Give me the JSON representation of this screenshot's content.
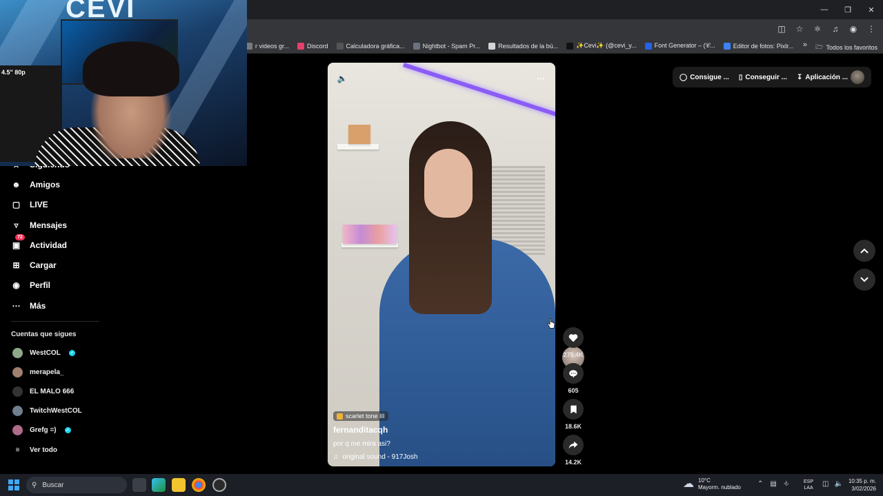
{
  "browser": {
    "bookmarks": [
      {
        "label": "r videos gr...",
        "color": "#7a7a7a"
      },
      {
        "label": "Discord",
        "color": "#e5416b"
      },
      {
        "label": "Calculadora gráfica...",
        "color": "#555555"
      },
      {
        "label": "Nightbot - Spam Pr...",
        "color": "#6b7280"
      },
      {
        "label": "Resultados de la bú...",
        "color": "#d4d4d4"
      },
      {
        "label": "✨Cevi✨ (@cevi_y...",
        "color": "#111111"
      },
      {
        "label": "Font Generator – (𝒞...",
        "color": "#2563eb"
      },
      {
        "label": "Editor de fotos: Pixlr...",
        "color": "#3b82f6"
      }
    ],
    "all_bookmarks": "Todos los favoritos"
  },
  "sidebar": {
    "partial_label": "Siguiendo",
    "items": [
      {
        "label": "Amigos",
        "icon": "friends-icon"
      },
      {
        "label": "LIVE",
        "icon": "live-icon"
      },
      {
        "label": "Mensajes",
        "icon": "messages-icon"
      },
      {
        "label": "Actividad",
        "icon": "activity-icon",
        "badge": "72"
      },
      {
        "label": "Cargar",
        "icon": "upload-icon"
      },
      {
        "label": "Perfil",
        "icon": "profile-icon"
      },
      {
        "label": "Más",
        "icon": "more-icon"
      }
    ],
    "following_title": "Cuentas que sigues",
    "following": [
      {
        "name": "WestCOL",
        "verified": true,
        "color": "#8fa88a"
      },
      {
        "name": "merapela_",
        "verified": false,
        "color": "#a08070"
      },
      {
        "name": "EL MALO 666",
        "verified": false,
        "color": "#333333"
      },
      {
        "name": "TwitchWestCOL",
        "verified": false,
        "color": "#6f7f8f"
      },
      {
        "name": "Grefg =)",
        "verified": true,
        "color": "#b06a8a"
      }
    ],
    "see_all": "Ver todo"
  },
  "video": {
    "sticker": "scarlet tone III",
    "username": "fernanditacqh",
    "caption": "por q me mira asi?",
    "sound": "original sound - 917Josh"
  },
  "actions": {
    "likes": "275.4K",
    "comments": "605",
    "saves": "18.6K",
    "shares": "14.2K"
  },
  "topbar": {
    "coins": "Consigue ...",
    "get": "Conseguir ...",
    "app": "Aplicación ..."
  },
  "webcam": {
    "logo": "CEVI",
    "overlay_text": "4.5\" 80p"
  },
  "taskbar": {
    "search": "Buscar",
    "temp": "10°C",
    "weather": "Mayorm. nublado",
    "lang1": "ESP",
    "lang2": "LAA",
    "time": "10:35 p. m.",
    "date": "3/02/2026"
  }
}
